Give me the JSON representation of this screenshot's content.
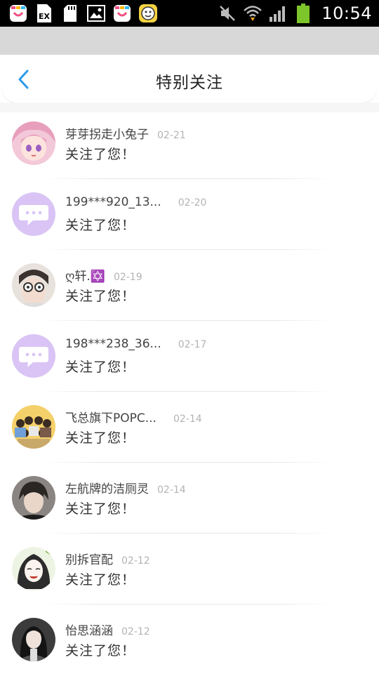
{
  "status_bar": {
    "time": "10:54",
    "left_icons": [
      "app-icon",
      "doc-icon",
      "sdcard-icon",
      "image-icon",
      "app-icon",
      "emoji-icon"
    ],
    "right_icons": [
      "mute-icon",
      "wifi-icon",
      "signal-icon",
      "battery-icon"
    ],
    "doc_icon_text": "EX"
  },
  "header": {
    "title": "特别关注"
  },
  "items": [
    {
      "name": "芽芽拐走小兔子",
      "date": "02-21",
      "message": "关注了您！",
      "avatar": "anime-girl"
    },
    {
      "name": "199***920_13...",
      "date": "02-20",
      "message": "关注了您！",
      "avatar": "default-chat"
    },
    {
      "name": "ღ轩.✡️",
      "date": "02-19",
      "message": "关注了您！",
      "avatar": "photo-boy"
    },
    {
      "name": "198***238_36...",
      "date": "02-17",
      "message": "关注了您！",
      "avatar": "default-chat"
    },
    {
      "name": "飞总旗下POPC...",
      "date": "02-14",
      "message": "关注了您！",
      "avatar": "group-photo"
    },
    {
      "name": "左航牌的洁厕灵",
      "date": "02-14",
      "message": "关注了您！",
      "avatar": "photo-portrait"
    },
    {
      "name": "别拆官配",
      "date": "02-12",
      "message": "关注了您！",
      "avatar": "sketch-girl"
    },
    {
      "name": "怡思涵涵",
      "date": "02-12",
      "message": "关注了您！",
      "avatar": "photo-woman"
    }
  ],
  "colors": {
    "accent": "#2a9bea",
    "default_avatar_bg": "#d9c4f5",
    "battery": "#7cc52a"
  }
}
